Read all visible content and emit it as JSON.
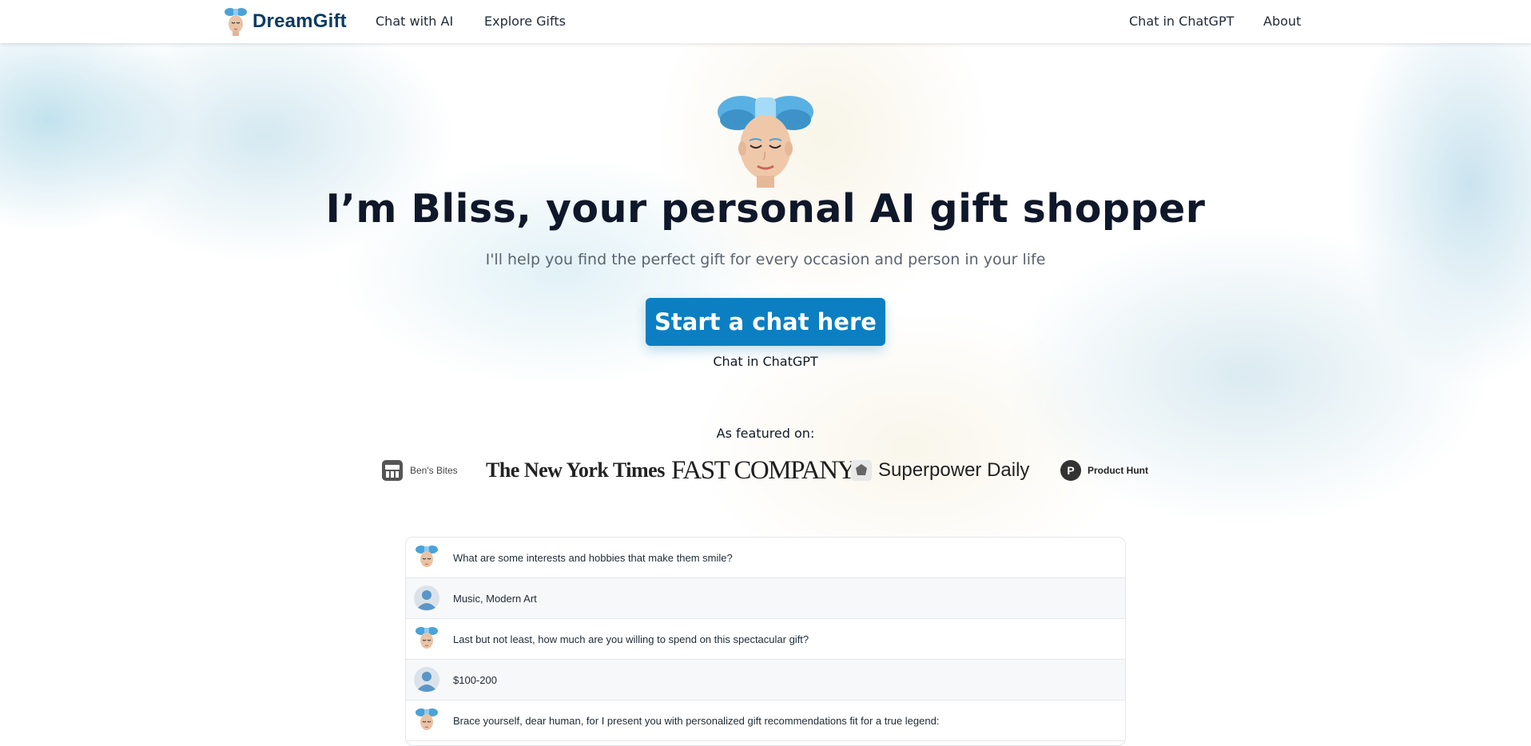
{
  "nav": {
    "brand": "DreamGift",
    "links_left": [
      "Chat with AI",
      "Explore Gifts"
    ],
    "links_right": [
      "Chat in ChatGPT",
      "About"
    ]
  },
  "hero": {
    "title": "I’m Bliss, your personal AI gift shopper",
    "subtitle": "I'll help you find the perfect gift for every occasion and person in your life",
    "cta_label": "Start a chat here",
    "cta_secondary": "Chat in ChatGPT"
  },
  "featured": {
    "label": "As featured on:",
    "logos": [
      "Ben's Bites",
      "The New York Times",
      "FAST COMPANY",
      "Superpower Daily",
      "Product Hunt"
    ]
  },
  "chat": {
    "messages": [
      {
        "role": "bot",
        "text": "What are some interests and hobbies that make them smile?"
      },
      {
        "role": "user",
        "text": "Music, Modern Art"
      },
      {
        "role": "bot",
        "text": "Last but not least, how much are you willing to spend on this spectacular gift?"
      },
      {
        "role": "user",
        "text": "$100-200"
      },
      {
        "role": "bot",
        "text": "Brace yourself, dear human, for I present you with personalized gift recommendations fit for a true legend:"
      }
    ]
  },
  "colors": {
    "primary": "#0b7fc2",
    "brand_text": "#0b3b63",
    "heading": "#0f172a",
    "muted": "#5b6470"
  }
}
